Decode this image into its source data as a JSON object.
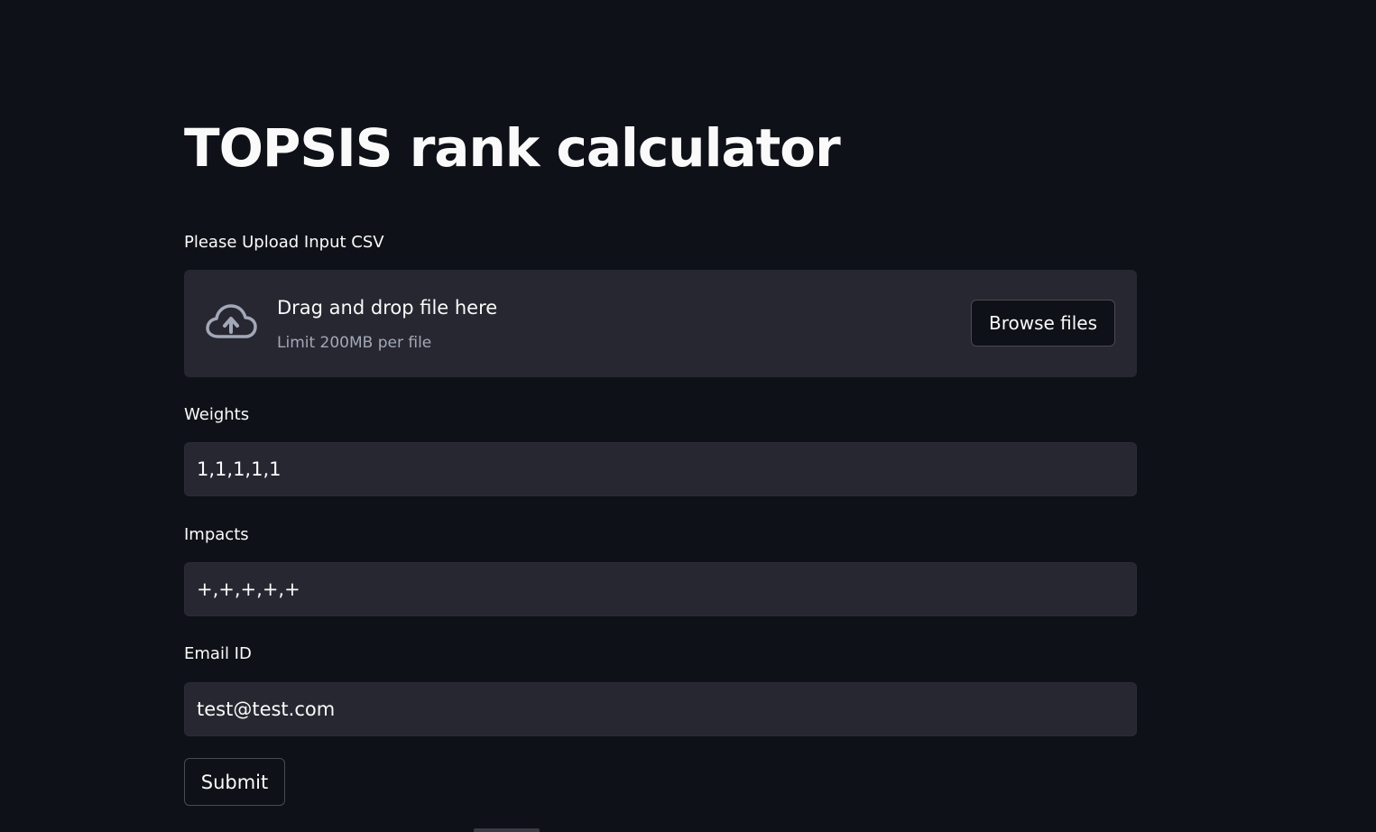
{
  "app": {
    "title": "TOPSIS rank calculator",
    "background": "#0e1117",
    "surface": "#262730",
    "text_color": "#fafafa",
    "muted_color": "#a3a8b8"
  },
  "uploader": {
    "label": "Please Upload Input CSV",
    "icon": "cloud-upload-icon",
    "drop_text": "Drag and drop file here",
    "limit_text": "Limit 200MB per file",
    "browse_label": "Browse files"
  },
  "weights": {
    "label": "Weights",
    "value": "1,1,1,1,1"
  },
  "impacts": {
    "label": "Impacts",
    "value": "+,+,+,+,+"
  },
  "email": {
    "label": "Email ID",
    "value": "test@test.com"
  },
  "submit": {
    "label": "Submit"
  }
}
